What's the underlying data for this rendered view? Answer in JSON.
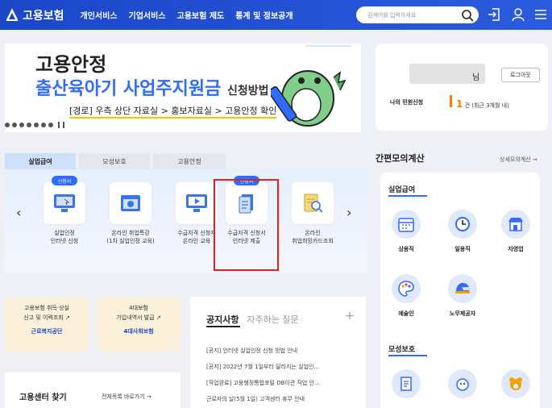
{
  "header": {
    "logo_text": "고용보험",
    "nav": [
      "개인서비스",
      "기업서비스",
      "고용보험 제도",
      "통계 및 정보공개"
    ],
    "search_placeholder": "검색어를 입력하세요"
  },
  "banner": {
    "line1": "고용안정",
    "line2": "출산육아기 사업주지원금",
    "line2_suffix": "신청방법",
    "line3": "[경로] 우측 상단 자료실 > 홍보자료실 > 고용안정 확인"
  },
  "user": {
    "suffix": "님",
    "logout": "로그아웃",
    "civil_label": "나의 민원신청",
    "civil_count": "1",
    "civil_unit": "건 (최근 3개월 내)"
  },
  "tabs": [
    "실업급여",
    "모성보호",
    "고용안정"
  ],
  "services": [
    {
      "badge": "신청서",
      "label": "실업인정\n인터넷 신청"
    },
    {
      "badge": "",
      "label": "온라인 취업특강\n(1차 실업인정 교육)"
    },
    {
      "badge": "",
      "label": "수급자격 신청자\n온라인 교육"
    },
    {
      "badge": "신청서",
      "label": "수급자격 신청서\n인터넷 제출"
    },
    {
      "badge": "",
      "label": "온라인\n취업희망카드조회"
    }
  ],
  "calc": {
    "title": "간편모의계산",
    "more": "상세모의계산 →",
    "section1": "실업급여",
    "items1": [
      "상용직",
      "일용직",
      "자영업",
      "예술인",
      "노무제공자"
    ],
    "section2": "모성보호"
  },
  "mini1": {
    "text": "고용보험 취득·상실\n신고 및 이력조회 ↗",
    "source": "근로복지공단"
  },
  "mini2": {
    "text": "4대보험\n가입내역서 발급 ↗",
    "source": "4대사회보험"
  },
  "notice": {
    "tab_on": "공지사항",
    "tab_off": "자주하는 질문",
    "items": [
      "[공지] 인터넷 실업인정 신청 방법 안내",
      "[공지] 2022년 7월 1일부터 달라지는 실업인...",
      "[작업완료] 고용행정통합포털 DB이관 작업 안...",
      "근로자의 날(5월 1일) 고객센터 휴무 안내"
    ]
  },
  "center": {
    "title": "고용센터 찾기",
    "more": "전체목록 바로가기 →"
  },
  "colors": {
    "primary": "#1a47c7",
    "accent": "#2f6bff",
    "highlight": "#e02020"
  }
}
